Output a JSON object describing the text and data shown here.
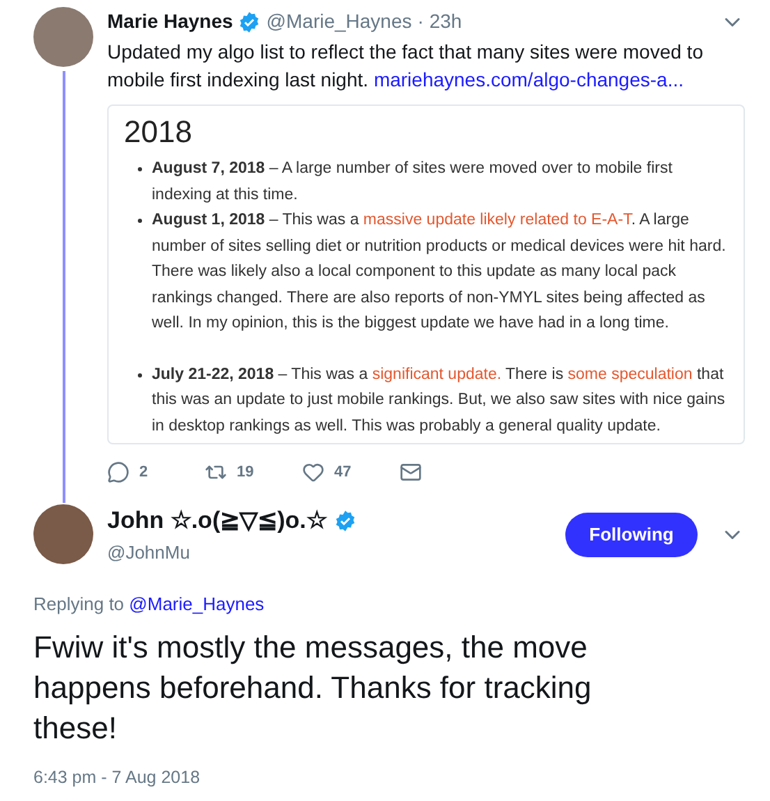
{
  "tweet": {
    "name": "Marie Haynes",
    "verified": true,
    "handle": "@Marie_Haynes",
    "time": "· 23h",
    "text": "Updated my algo list to reflect the fact that many sites were moved to mobile first indexing last night.",
    "link": "mariehaynes.com/algo-changes-a...",
    "card": {
      "heading": "2018",
      "items": [
        [
          {
            "kind": "bold",
            "text": "August 7, 2018"
          },
          {
            "kind": "text",
            "text": " – A large number of sites were moved over to mobile first indexing at this time."
          }
        ],
        [
          {
            "kind": "bold",
            "text": "August 1, 2018"
          },
          {
            "kind": "text",
            "text": " – This was a "
          },
          {
            "kind": "link",
            "text": "massive update likely related to E-A-T"
          },
          {
            "kind": "text",
            "text": ". A large number of sites selling diet or nutrition products or medical devices were hit hard. There was likely also a local component to this update as many local pack rankings changed. There are also reports of non-YMYL sites being affected as well. In my opinion, this is the biggest update we have had in a long time."
          }
        ],
        [
          {
            "kind": "bold",
            "text": "July 21-22, 2018"
          },
          {
            "kind": "text",
            "text": " – This was a "
          },
          {
            "kind": "link",
            "text": "significant update."
          },
          {
            "kind": "text",
            "text": " There is "
          },
          {
            "kind": "link",
            "text": "some speculation"
          },
          {
            "kind": "text",
            "text": " that this was an update to just mobile rankings. But, we also saw sites with nice gains in desktop rankings as well. This was probably a general quality update."
          }
        ]
      ]
    },
    "actions": [
      {
        "kind": "reply",
        "count": "2"
      },
      {
        "kind": "retweet",
        "count": "19"
      },
      {
        "kind": "like",
        "count": "47"
      },
      {
        "kind": "message"
      }
    ]
  },
  "reply": {
    "name": "John ☆.o(≧▽≦)o.☆",
    "verified": true,
    "handle": "@JohnMu",
    "follow_button": "Following",
    "replying_to": "Replying to",
    "replying_handle": "@Marie_Haynes",
    "text": "Fwiw it's mostly the messages, the move happens beforehand. Thanks for tracking these!",
    "timestamp": "6:43 pm - 7 Aug 2018"
  }
}
